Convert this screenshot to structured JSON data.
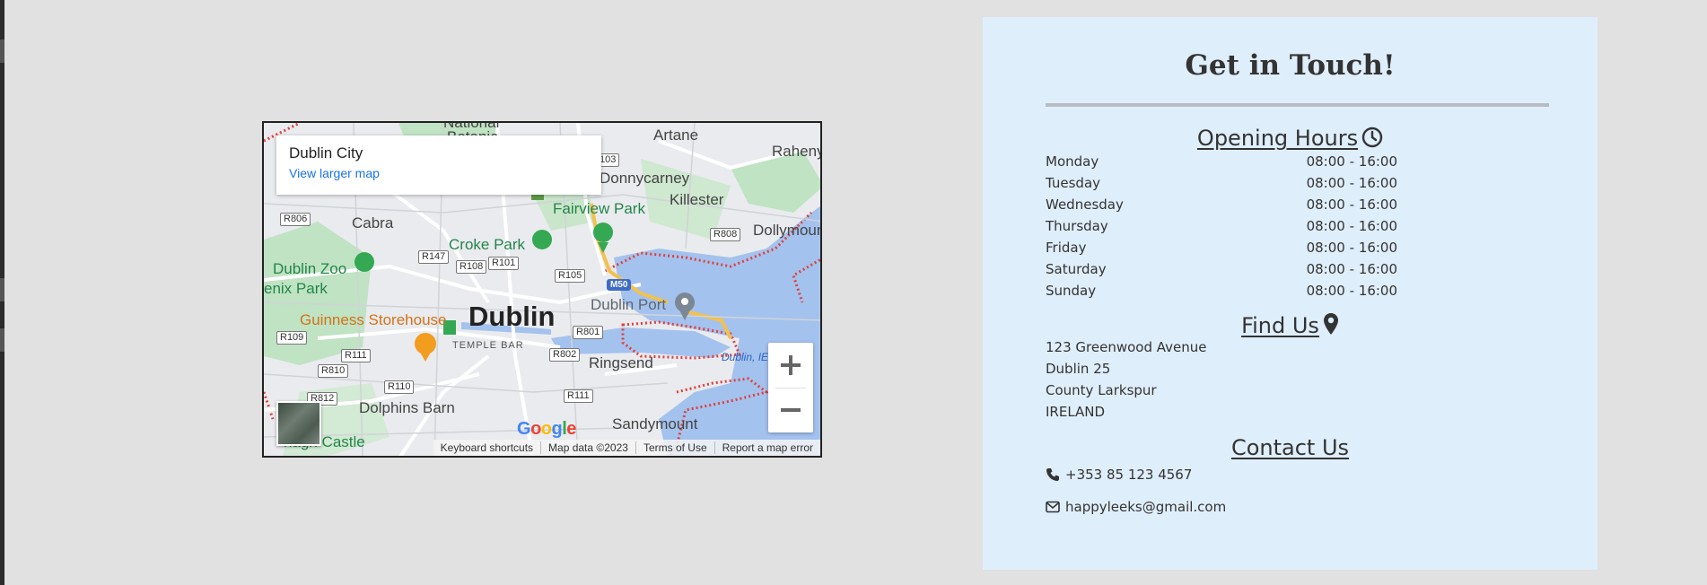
{
  "map": {
    "info_title": "Dublin City",
    "info_link": "View larger map",
    "labels": {
      "national": "National",
      "botanic": "Botanic",
      "artane": "Artane",
      "raheny": "Raheny",
      "donnycarney": "Donnycarney",
      "killester": "Killester",
      "fairview_park": "Fairview Park",
      "dollymount": "Dollymount",
      "cabra": "Cabra",
      "croke_park": "Croke Park",
      "dublin_zoo": "Dublin Zoo",
      "phoenix_park": "enix Park",
      "guinness": "Guinness Storehouse",
      "dublin": "Dublin",
      "temple_bar": "TEMPLE BAR",
      "dublin_port": "Dublin Port",
      "ringsend": "Ringsend",
      "dublin_bay": "Dublin, IE",
      "dolphins_barn": "Dolphins Barn",
      "sandymount": "Sandymount",
      "crumlin_castle": "nagh Castle"
    },
    "roads": {
      "r103": "103",
      "r806": "R806",
      "r808": "R808",
      "r147": "R147",
      "r108": "R108",
      "r101": "R101",
      "r105": "R105",
      "m50": "M50",
      "r109": "R109",
      "r801": "R801",
      "r111a": "R111",
      "r802": "R802",
      "r810": "R810",
      "r812": "R812",
      "r110": "R110",
      "r111b": "R111"
    },
    "google": "Google",
    "footer": {
      "keyboard": "Keyboard shortcuts",
      "mapdata": "Map data ©2023",
      "terms": "Terms of Use",
      "report": "Report a map error"
    }
  },
  "contact": {
    "heading": "Get in Touch!",
    "opening_title": "Opening Hours",
    "hours": [
      {
        "day": "Monday",
        "time": "08:00 - 16:00"
      },
      {
        "day": "Tuesday",
        "time": "08:00 - 16:00"
      },
      {
        "day": "Wednesday",
        "time": "08:00 - 16:00"
      },
      {
        "day": "Thursday",
        "time": "08:00 - 16:00"
      },
      {
        "day": "Friday",
        "time": "08:00 - 16:00"
      },
      {
        "day": "Saturday",
        "time": "08:00 - 16:00"
      },
      {
        "day": "Sunday",
        "time": "08:00 - 16:00"
      }
    ],
    "find_title": "Find Us",
    "address": [
      "123 Greenwood Avenue",
      "Dublin 25",
      "County Larkspur",
      "IRELAND"
    ],
    "contact_title": "Contact Us",
    "phone": "+353 85 123 4567",
    "email": "happyleeks@gmail.com"
  },
  "colors": {
    "background": "#e1e1e1",
    "panel": "#dfeefb",
    "text": "#333333",
    "link": "#1a73e8",
    "water": "#a4c2ee",
    "park": "#bfe3c3"
  }
}
